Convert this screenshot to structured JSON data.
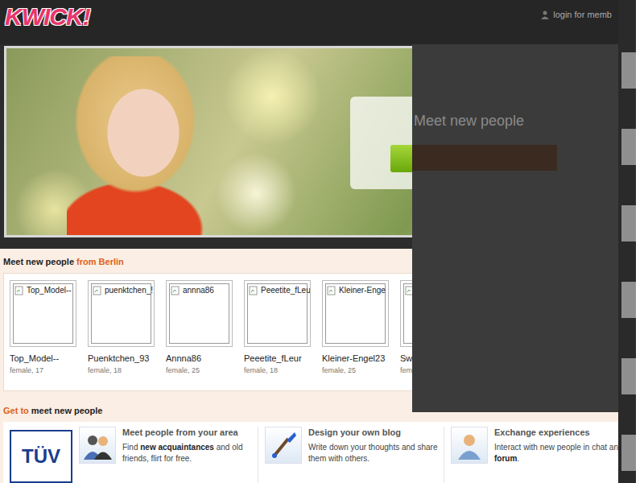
{
  "header": {
    "logo": "KWICK!",
    "login": "login for memb"
  },
  "overlay": {
    "title": "Meet new people"
  },
  "people_section": {
    "title_lead": "Meet new people",
    "title_accent": "from Berlin",
    "people": [
      {
        "thumb_label": "Top_Model--",
        "name": "Top_Model--",
        "info": "female, 17"
      },
      {
        "thumb_label": "puenktchen_!",
        "name": "Puenktchen_93",
        "info": "female, 18"
      },
      {
        "thumb_label": "annna86",
        "name": "Annna86",
        "info": "female, 25"
      },
      {
        "thumb_label": "Peeetite_fLeu",
        "name": "Peeetite_fLeur",
        "info": "female, 18"
      },
      {
        "thumb_label": "Kleiner-Enge",
        "name": "Kleiner-Engel23",
        "info": "female, 25"
      },
      {
        "thumb_label": "",
        "name": "Swe",
        "info": "fema"
      }
    ]
  },
  "features_section": {
    "title_accent": "Get to",
    "title_lead": "meet new people",
    "badge": "TÜV",
    "features": [
      {
        "kind": "people",
        "title": "Meet people from your area",
        "description": [
          {
            "text": "Find ",
            "bold": false
          },
          {
            "text": "new acquaintances",
            "bold": true
          },
          {
            "text": " and old friends, flirt for free.",
            "bold": false
          }
        ]
      },
      {
        "kind": "brush",
        "title": "Design your own blog",
        "description": [
          {
            "text": "Write down your thoughts and share them with others.",
            "bold": false
          }
        ]
      },
      {
        "kind": "person",
        "title": "Exchange experiences",
        "description": [
          {
            "text": "Interact with new people in chat an ",
            "bold": false
          },
          {
            "text": "forum",
            "bold": true
          },
          {
            "text": ".",
            "bold": false
          }
        ]
      }
    ]
  }
}
